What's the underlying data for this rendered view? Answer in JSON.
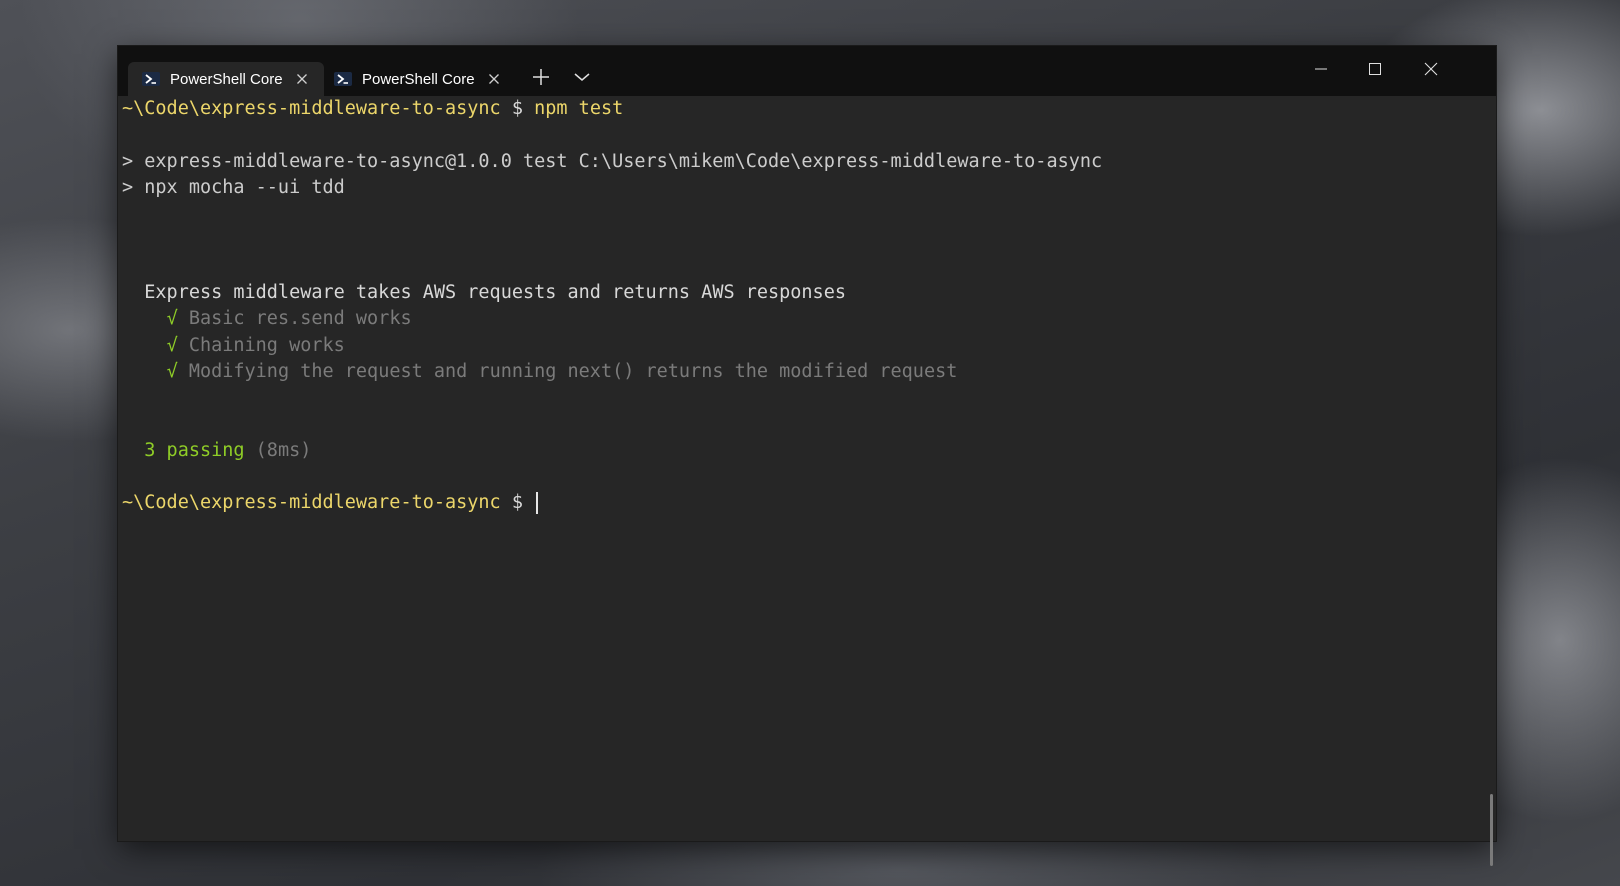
{
  "window": {
    "tabs": [
      {
        "label": "PowerShell Core",
        "active": true,
        "icon": "powershell-icon"
      },
      {
        "label": "PowerShell Core",
        "active": false,
        "icon": "powershell-icon"
      }
    ],
    "new_tab_icon": "plus-icon",
    "dropdown_icon": "chevron-down-icon",
    "caption_buttons": [
      "minimize-icon",
      "maximize-icon",
      "close-icon"
    ]
  },
  "terminal": {
    "prompt_path": "~\\Code\\express-middleware-to-async",
    "prompt_symbol": "$",
    "command": "npm test",
    "script_line_1": "> express-middleware-to-async@1.0.0 test C:\\Users\\mikem\\Code\\express-middleware-to-async",
    "script_line_2": "> npx mocha --ui tdd",
    "suite_title": "Express middleware takes AWS requests and returns AWS responses",
    "check_mark": "√",
    "tests": [
      "Basic res.send works",
      "Chaining works",
      "Modifying the request and running next() returns the modified request"
    ],
    "passing": "3 passing",
    "duration": "(8ms)"
  },
  "colors": {
    "prompt": "#ecd66a",
    "pass": "#8fcd27",
    "muted": "#7b7b7b",
    "background": "#262626",
    "titlebar": "#101010"
  }
}
